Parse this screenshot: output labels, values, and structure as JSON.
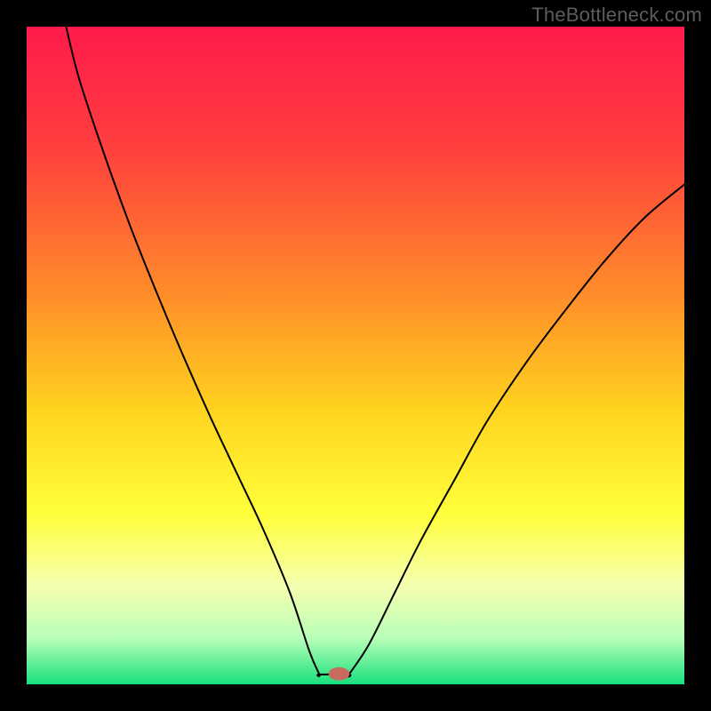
{
  "watermark": "TheBottleneck.com",
  "chart_data": {
    "type": "line",
    "title": "",
    "xlabel": "",
    "ylabel": "",
    "xlim": [
      0,
      100
    ],
    "ylim": [
      0,
      100
    ],
    "gradient_stops": [
      {
        "offset": 0,
        "color": "#ff1a4b"
      },
      {
        "offset": 18,
        "color": "#ff3e3e"
      },
      {
        "offset": 40,
        "color": "#ff8a2a"
      },
      {
        "offset": 58,
        "color": "#ffd21f"
      },
      {
        "offset": 74,
        "color": "#ffff3a"
      },
      {
        "offset": 85,
        "color": "#f6ffb0"
      },
      {
        "offset": 93,
        "color": "#b8ffb8"
      },
      {
        "offset": 100,
        "color": "#18e07c"
      }
    ],
    "series": [
      {
        "name": "left-branch",
        "x": [
          6,
          8,
          12,
          16,
          20,
          24,
          28,
          32,
          36,
          40,
          43,
          44.5
        ],
        "y": [
          100,
          92,
          80,
          69,
          59,
          49.5,
          40.5,
          32,
          23.5,
          14,
          5,
          1.5
        ]
      },
      {
        "name": "flat-bottom",
        "x": [
          44.5,
          49
        ],
        "y": [
          1.5,
          1.5
        ]
      },
      {
        "name": "right-branch",
        "x": [
          49,
          52,
          56,
          60,
          65,
          70,
          76,
          82,
          88,
          94,
          100
        ],
        "y": [
          1.5,
          6,
          14,
          22,
          31,
          40,
          49,
          57,
          64.5,
          71,
          76
        ]
      }
    ],
    "marker": {
      "x": 47.5,
      "y": 1.6,
      "rx": 1.6,
      "ry": 1.0,
      "color": "#c96a5f"
    }
  }
}
